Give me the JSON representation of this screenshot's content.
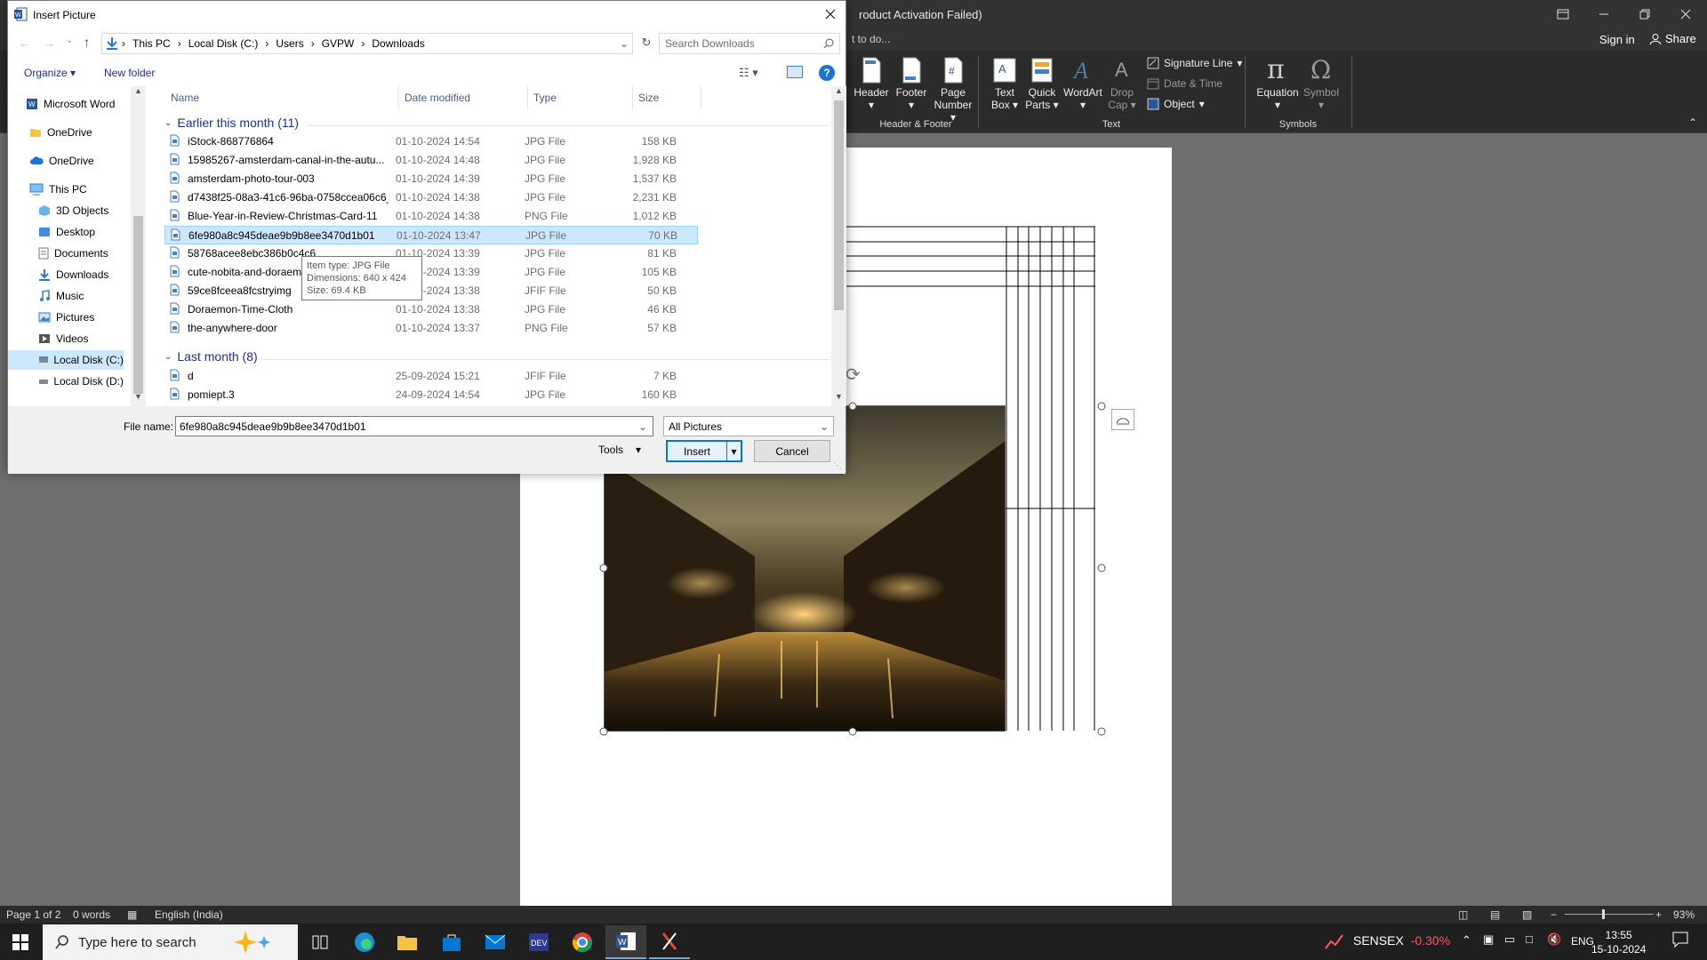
{
  "word": {
    "title": "roduct Activation Failed)",
    "tell_me": "t to do...",
    "sign_in": "Sign in",
    "share": "Share",
    "ribbon": {
      "header": "Header",
      "footer": "Footer",
      "page_number_1": "Page",
      "page_number_2": "Number",
      "text_box_1": "Text",
      "text_box_2": "Box",
      "quick_parts_1": "Quick",
      "quick_parts_2": "Parts",
      "wordart": "WordArt",
      "drop_cap_1": "Drop",
      "drop_cap_2": "Cap",
      "signature_line": "Signature Line",
      "date_time": "Date & Time",
      "object": "Object",
      "equation": "Equation",
      "symbol": "Symbol",
      "group_header_footer": "Header & Footer",
      "group_text": "Text",
      "group_symbols": "Symbols"
    },
    "status": {
      "page": "Page 1 of 2",
      "words": "0 words",
      "language": "English (India)",
      "zoom": "93%"
    }
  },
  "taskbar": {
    "search_placeholder": "Type here to search",
    "sensex_label": "SENSEX",
    "sensex_change": "-0.30%",
    "lang": "ENG",
    "time": "13:55",
    "date": "15-10-2024"
  },
  "dialog": {
    "title": "Insert Picture",
    "breadcrumb": [
      "This PC",
      "Local Disk (C:)",
      "Users",
      "GVPW",
      "Downloads"
    ],
    "search_placeholder": "Search Downloads",
    "organize": "Organize",
    "new_folder": "New folder",
    "nav": [
      "Microsoft Word",
      "OneDrive",
      "OneDrive",
      "This PC",
      "3D Objects",
      "Desktop",
      "Documents",
      "Downloads",
      "Music",
      "Pictures",
      "Videos",
      "Local Disk (C:)",
      "Local Disk (D:)"
    ],
    "columns": {
      "name": "Name",
      "date": "Date modified",
      "type": "Type",
      "size": "Size"
    },
    "groups": {
      "earlier": "Earlier this month (11)",
      "last": "Last month (8)"
    },
    "files": [
      {
        "name": "iStock-868776864",
        "date": "01-10-2024 14:54",
        "type": "JPG File",
        "size": "158 KB"
      },
      {
        "name": "15985267-amsterdam-canal-in-the-autu...",
        "date": "01-10-2024 14:48",
        "type": "JPG File",
        "size": "1,928 KB"
      },
      {
        "name": "amsterdam-photo-tour-003",
        "date": "01-10-2024 14:39",
        "type": "JPG File",
        "size": "1,537 KB"
      },
      {
        "name": "d7438f25-08a3-41c6-96ba-0758ccea06c6_...",
        "date": "01-10-2024 14:38",
        "type": "JPG File",
        "size": "2,231 KB"
      },
      {
        "name": "Blue-Year-in-Review-Christmas-Card-11",
        "date": "01-10-2024 14:38",
        "type": "PNG File",
        "size": "1,012 KB"
      },
      {
        "name": "6fe980a8c945deae9b9b8ee3470d1b01",
        "date": "01-10-2024 13:47",
        "type": "JPG File",
        "size": "70 KB"
      },
      {
        "name": "58768acee8ebc386b0c4c6",
        "date": "01-10-2024 13:39",
        "type": "JPG File",
        "size": "81 KB"
      },
      {
        "name": "cute-nobita-and-doraem",
        "date": "01-10-2024 13:39",
        "type": "JPG File",
        "size": "105 KB"
      },
      {
        "name": "59ce8fceea8fcstryimg",
        "date": "01-10-2024 13:38",
        "type": "JFIF File",
        "size": "50 KB"
      },
      {
        "name": "Doraemon-Time-Cloth",
        "date": "01-10-2024 13:38",
        "type": "JPG File",
        "size": "46 KB"
      },
      {
        "name": "the-anywhere-door",
        "date": "01-10-2024 13:37",
        "type": "PNG File",
        "size": "57 KB"
      }
    ],
    "files_last": [
      {
        "name": "d",
        "date": "25-09-2024 15:21",
        "type": "JFIF File",
        "size": "7 KB"
      },
      {
        "name": "pomiept.3",
        "date": "24-09-2024 14:54",
        "type": "JPG File",
        "size": "160 KB"
      }
    ],
    "tooltip": {
      "type": "Item type: JPG File",
      "dimensions": "Dimensions: 640 x 424",
      "size": "Size: 69.4 KB"
    },
    "file_name_label": "File name:",
    "file_name_value": "6fe980a8c945deae9b9b8ee3470d1b01",
    "filter": "All Pictures",
    "tools": "Tools",
    "insert": "Insert",
    "cancel": "Cancel"
  },
  "colors": {
    "accent": "#0078d7",
    "selection": "#cce8ff",
    "ribbon_bg": "#2b2b2b",
    "taskbar_bg": "#1f1f1f",
    "sensex_negative": "#ff5a5a"
  }
}
